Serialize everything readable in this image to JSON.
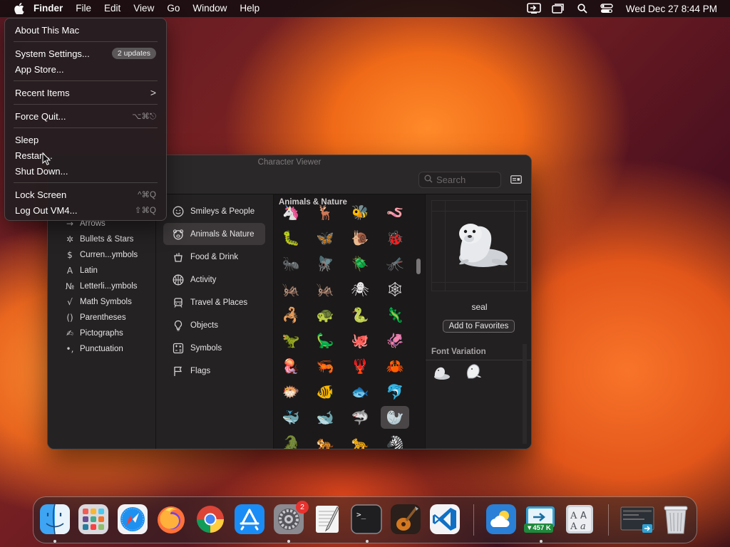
{
  "menubar": {
    "app_name": "Finder",
    "items": [
      "File",
      "Edit",
      "View",
      "Go",
      "Window",
      "Help"
    ],
    "clock": "Wed Dec 27  8:44 PM",
    "status_icons": [
      "screen-sharing-icon",
      "window-mirror-icon",
      "spotlight-search-icon",
      "control-center-icon"
    ]
  },
  "apple_menu": {
    "about": "About This Mac",
    "system_settings": "System Settings...",
    "updates_badge": "2 updates",
    "app_store": "App Store...",
    "recent_items": "Recent Items",
    "recent_items_arrow": ">",
    "force_quit": "Force Quit...",
    "force_quit_shortcut": "⌥⌘⎋",
    "sleep": "Sleep",
    "restart": "Restart...",
    "shut_down": "Shut Down...",
    "lock_screen": "Lock Screen",
    "lock_screen_shortcut": "^⌘Q",
    "log_out": "Log Out VM4...",
    "log_out_shortcut": "⇧⌘Q"
  },
  "character_viewer": {
    "title": "Character Viewer",
    "search_placeholder": "Search",
    "left_list": [
      {
        "glyph": "→",
        "label": "Arrows"
      },
      {
        "glyph": "✲",
        "label": "Bullets & Stars"
      },
      {
        "glyph": "$",
        "label": "Curren...ymbols"
      },
      {
        "glyph": "A",
        "label": "Latin"
      },
      {
        "glyph": "№",
        "label": "Letterli...ymbols"
      },
      {
        "glyph": "√",
        "label": "Math Symbols"
      },
      {
        "glyph": "()",
        "label": "Parentheses"
      },
      {
        "glyph": "✍",
        "label": "Pictographs"
      },
      {
        "glyph": "•,",
        "label": "Punctuation"
      }
    ],
    "categories": [
      {
        "icon": "smiley-icon",
        "label": "Smileys & People"
      },
      {
        "icon": "bear-icon",
        "label": "Animals & Nature"
      },
      {
        "icon": "food-icon",
        "label": "Food & Drink"
      },
      {
        "icon": "activity-icon",
        "label": "Activity"
      },
      {
        "icon": "travel-icon",
        "label": "Travel & Places"
      },
      {
        "icon": "objects-icon",
        "label": "Objects"
      },
      {
        "icon": "symbols-icon",
        "label": "Symbols"
      },
      {
        "icon": "flag-icon",
        "label": "Flags"
      }
    ],
    "active_category": "Animals & Nature",
    "grid_header": "Animals & Nature",
    "grid_rows": [
      [
        "🦄",
        "🦌",
        "🐝",
        "🪱"
      ],
      [
        "🐛",
        "🦋",
        "🐌",
        "🐞"
      ],
      [
        "🐜",
        "🪰",
        "🪲",
        "🦟"
      ],
      [
        "🦗",
        "🦗",
        "🕷",
        "🕸"
      ],
      [
        "🦂",
        "🐢",
        "🐍",
        "🦎"
      ],
      [
        "🦖",
        "🦕",
        "🐙",
        "🦑"
      ],
      [
        "🪼",
        "🦐",
        "🦞",
        "🦀"
      ],
      [
        "🐡",
        "🐠",
        "🐟",
        "🐬"
      ],
      [
        "🐳",
        "🐋",
        "🦈",
        "🦭"
      ],
      [
        "🐊",
        "🐅",
        "🐆",
        "🦓"
      ]
    ],
    "selected_char": "🦭",
    "selected_name": "seal",
    "add_to_favorites": "Add to Favorites",
    "font_variation_label": "Font Variation",
    "font_variations": [
      "🦭",
      "🦭"
    ]
  },
  "dock": {
    "apps": [
      {
        "name": "Finder"
      },
      {
        "name": "Launchpad"
      },
      {
        "name": "Safari"
      },
      {
        "name": "Firefox"
      },
      {
        "name": "Google Chrome"
      },
      {
        "name": "App Store"
      },
      {
        "name": "System Settings"
      },
      {
        "name": "TextEdit"
      },
      {
        "name": "Terminal"
      },
      {
        "name": "GarageBand"
      },
      {
        "name": "Visual Studio Code"
      },
      {
        "name": "Weather"
      },
      {
        "name": "Screen Sharing"
      },
      {
        "name": "Font Book"
      }
    ],
    "settings_badge": "2",
    "net_badge": "▼457 K",
    "terminal_prompt": ">_"
  }
}
